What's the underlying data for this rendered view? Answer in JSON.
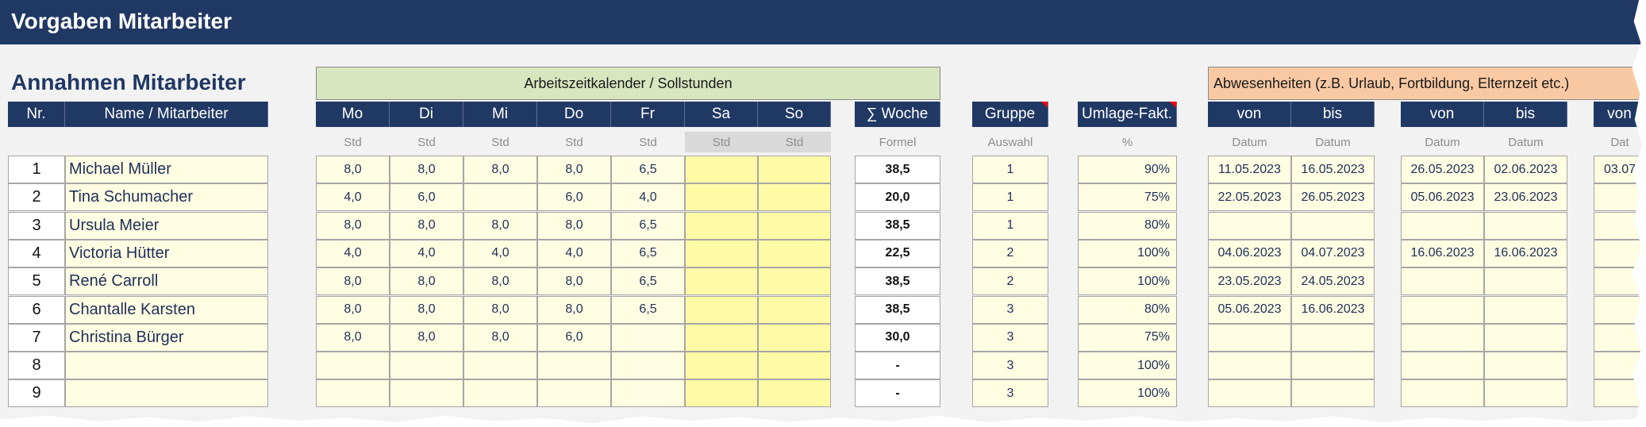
{
  "title": "Vorgaben Mitarbeiter",
  "section_title": "Annahmen Mitarbeiter",
  "banners": {
    "calendar": "Arbeitszeitkalender / Sollstunden",
    "absences": "Abwesenheiten  (z.B. Urlaub, Fortbildung, Elternzeit etc.)"
  },
  "headers": {
    "nr": "Nr.",
    "name": "Name / Mitarbeiter",
    "mo": "Mo",
    "di": "Di",
    "mi": "Mi",
    "do": "Do",
    "fr": "Fr",
    "sa": "Sa",
    "so": "So",
    "woche": "∑ Woche",
    "gruppe": "Gruppe",
    "umlage": "Umlage-Fakt.",
    "von1": "von",
    "bis1": "bis",
    "von2": "von",
    "bis2": "bis",
    "von3": "von"
  },
  "subheaders": {
    "std": "Std",
    "formel": "Formel",
    "auswahl": "Auswahl",
    "percent": "%",
    "datum": "Datum",
    "datum_cut": "Dat"
  },
  "rows": [
    {
      "nr": "1",
      "name": "Michael Müller",
      "mo": "8,0",
      "di": "8,0",
      "mi": "8,0",
      "do": "8,0",
      "fr": "6,5",
      "woche": "38,5",
      "gruppe": "1",
      "umlage": "90%",
      "von1": "11.05.2023",
      "bis1": "16.05.2023",
      "von2": "26.05.2023",
      "bis2": "02.06.2023",
      "von3": "03.07"
    },
    {
      "nr": "2",
      "name": "Tina Schumacher",
      "mo": "4,0",
      "di": "6,0",
      "mi": "",
      "do": "6,0",
      "fr": "4,0",
      "woche": "20,0",
      "gruppe": "1",
      "umlage": "75%",
      "von1": "22.05.2023",
      "bis1": "26.05.2023",
      "von2": "05.06.2023",
      "bis2": "23.06.2023",
      "von3": ""
    },
    {
      "nr": "3",
      "name": "Ursula Meier",
      "mo": "8,0",
      "di": "8,0",
      "mi": "8,0",
      "do": "8,0",
      "fr": "6,5",
      "woche": "38,5",
      "gruppe": "1",
      "umlage": "80%",
      "von1": "",
      "bis1": "",
      "von2": "",
      "bis2": "",
      "von3": ""
    },
    {
      "nr": "4",
      "name": "Victoria Hütter",
      "mo": "4,0",
      "di": "4,0",
      "mi": "4,0",
      "do": "4,0",
      "fr": "6,5",
      "woche": "22,5",
      "gruppe": "2",
      "umlage": "100%",
      "von1": "04.06.2023",
      "bis1": "04.07.2023",
      "von2": "16.06.2023",
      "bis2": "16.06.2023",
      "von3": ""
    },
    {
      "nr": "5",
      "name": "René Carroll",
      "mo": "8,0",
      "di": "8,0",
      "mi": "8,0",
      "do": "8,0",
      "fr": "6,5",
      "woche": "38,5",
      "gruppe": "2",
      "umlage": "100%",
      "von1": "23.05.2023",
      "bis1": "24.05.2023",
      "von2": "",
      "bis2": "",
      "von3": ""
    },
    {
      "nr": "6",
      "name": "Chantalle Karsten",
      "mo": "8,0",
      "di": "8,0",
      "mi": "8,0",
      "do": "8,0",
      "fr": "6,5",
      "woche": "38,5",
      "gruppe": "3",
      "umlage": "80%",
      "von1": "05.06.2023",
      "bis1": "16.06.2023",
      "von2": "",
      "bis2": "",
      "von3": ""
    },
    {
      "nr": "7",
      "name": "Christina Bürger",
      "mo": "8,0",
      "di": "8,0",
      "mi": "8,0",
      "do": "6,0",
      "fr": "",
      "woche": "30,0",
      "gruppe": "3",
      "umlage": "75%",
      "von1": "",
      "bis1": "",
      "von2": "",
      "bis2": "",
      "von3": ""
    },
    {
      "nr": "8",
      "name": "",
      "mo": "",
      "di": "",
      "mi": "",
      "do": "",
      "fr": "",
      "woche": "-",
      "gruppe": "3",
      "umlage": "100%",
      "von1": "",
      "bis1": "",
      "von2": "",
      "bis2": "",
      "von3": ""
    },
    {
      "nr": "9",
      "name": "",
      "mo": "",
      "di": "",
      "mi": "",
      "do": "",
      "fr": "",
      "woche": "-",
      "gruppe": "3",
      "umlage": "100%",
      "von1": "",
      "bis1": "",
      "von2": "",
      "bis2": "",
      "von3": ""
    }
  ],
  "colors": {
    "header_bg": "#203864",
    "calendar_banner": "#d8e6bf",
    "absence_banner": "#f9c9a3",
    "input_cell": "#fffde2",
    "weekend_cell": "#fffaa6",
    "flag": "#ff0000"
  }
}
